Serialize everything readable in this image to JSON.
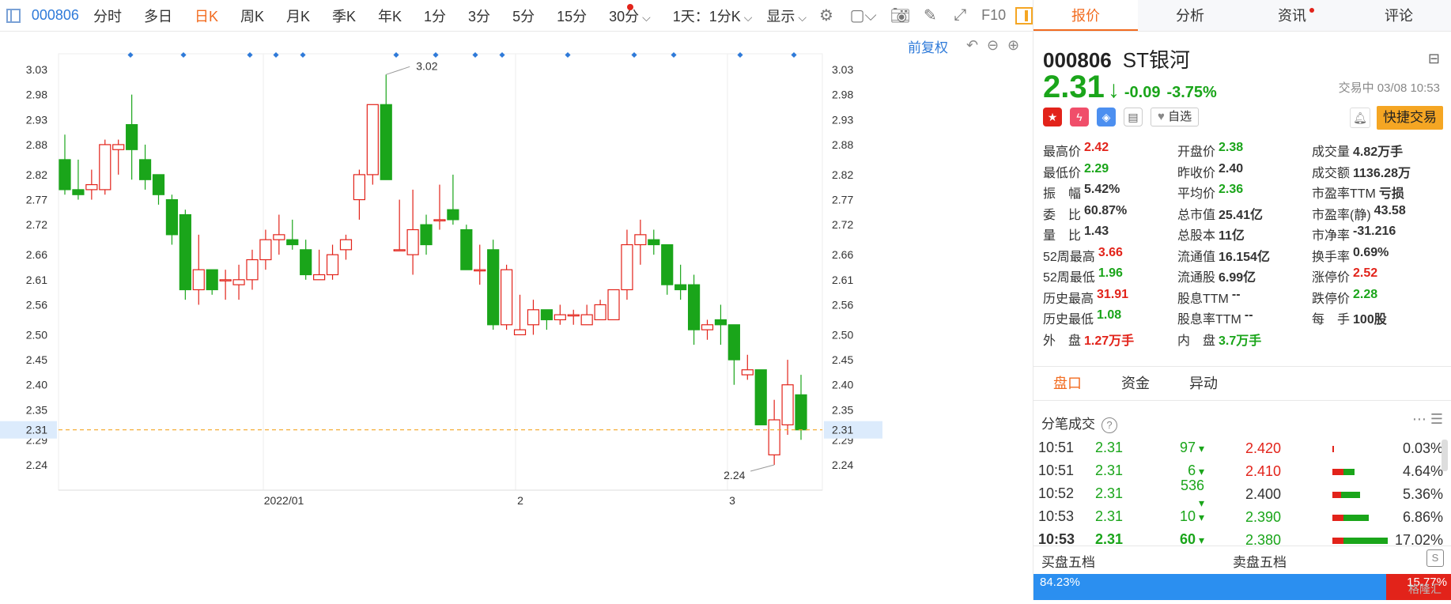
{
  "toolbar": {
    "code": "000806",
    "tabs": [
      "分时",
      "多日",
      "日K",
      "周K",
      "月K",
      "季K",
      "年K",
      "1分",
      "3分",
      "5分",
      "15分",
      "30分"
    ],
    "active_tab": "日K",
    "period_select": "1天：1分K",
    "display_select": "显示",
    "f10_label": "F10",
    "icons": [
      "settings-icon",
      "rect-icon",
      "camera-icon",
      "pencil-icon",
      "expand-icon"
    ]
  },
  "chart": {
    "adjust_label": "前复权",
    "current_price_tag": "2.31",
    "high_marker": "3.02",
    "low_marker": "2.24",
    "x_labels": [
      "2022/01",
      "2",
      "3"
    ],
    "y_labels": [
      "3.03",
      "2.98",
      "2.93",
      "2.88",
      "2.82",
      "2.77",
      "2.72",
      "2.66",
      "2.61",
      "2.56",
      "2.50",
      "2.45",
      "2.40",
      "2.35",
      "2.29",
      "2.24"
    ],
    "colors": {
      "up": "#e2231a",
      "down": "#1aa51a",
      "price_line": "#f5a623",
      "marker": "#2e7ad9"
    }
  },
  "chart_data": {
    "type": "candlestick",
    "x_labels": [
      "2022/01",
      "2",
      "3"
    ],
    "ylim": [
      2.22,
      3.05
    ],
    "candles": [
      {
        "o": 2.85,
        "h": 2.9,
        "l": 2.78,
        "c": 2.79
      },
      {
        "o": 2.79,
        "h": 2.85,
        "l": 2.77,
        "c": 2.78
      },
      {
        "o": 2.79,
        "h": 2.83,
        "l": 2.77,
        "c": 2.8
      },
      {
        "o": 2.79,
        "h": 2.89,
        "l": 2.78,
        "c": 2.88
      },
      {
        "o": 2.87,
        "h": 2.89,
        "l": 2.82,
        "c": 2.88
      },
      {
        "o": 2.92,
        "h": 2.98,
        "l": 2.81,
        "c": 2.87
      },
      {
        "o": 2.85,
        "h": 2.88,
        "l": 2.79,
        "c": 2.81
      },
      {
        "o": 2.82,
        "h": 2.82,
        "l": 2.76,
        "c": 2.78
      },
      {
        "o": 2.77,
        "h": 2.78,
        "l": 2.68,
        "c": 2.7
      },
      {
        "o": 2.74,
        "h": 2.75,
        "l": 2.57,
        "c": 2.59
      },
      {
        "o": 2.59,
        "h": 2.7,
        "l": 2.56,
        "c": 2.63
      },
      {
        "o": 2.63,
        "h": 2.63,
        "l": 2.58,
        "c": 2.59
      },
      {
        "o": 2.61,
        "h": 2.63,
        "l": 2.57,
        "c": 2.61
      },
      {
        "o": 2.6,
        "h": 2.64,
        "l": 2.57,
        "c": 2.61
      },
      {
        "o": 2.61,
        "h": 2.67,
        "l": 2.59,
        "c": 2.65
      },
      {
        "o": 2.65,
        "h": 2.71,
        "l": 2.63,
        "c": 2.69
      },
      {
        "o": 2.69,
        "h": 2.74,
        "l": 2.66,
        "c": 2.7
      },
      {
        "o": 2.69,
        "h": 2.73,
        "l": 2.67,
        "c": 2.68
      },
      {
        "o": 2.67,
        "h": 2.69,
        "l": 2.61,
        "c": 2.62
      },
      {
        "o": 2.61,
        "h": 2.67,
        "l": 2.61,
        "c": 2.62
      },
      {
        "o": 2.62,
        "h": 2.68,
        "l": 2.61,
        "c": 2.66
      },
      {
        "o": 2.67,
        "h": 2.7,
        "l": 2.65,
        "c": 2.69
      },
      {
        "o": 2.77,
        "h": 2.83,
        "l": 2.73,
        "c": 2.82
      },
      {
        "o": 2.82,
        "h": 2.96,
        "l": 2.8,
        "c": 2.96
      },
      {
        "o": 2.96,
        "h": 3.02,
        "l": 2.81,
        "c": 2.81
      },
      {
        "o": 2.67,
        "h": 2.77,
        "l": 2.67,
        "c": 2.67
      },
      {
        "o": 2.66,
        "h": 2.79,
        "l": 2.62,
        "c": 2.71
      },
      {
        "o": 2.72,
        "h": 2.74,
        "l": 2.66,
        "c": 2.68
      },
      {
        "o": 2.73,
        "h": 2.8,
        "l": 2.71,
        "c": 2.73
      },
      {
        "o": 2.75,
        "h": 2.82,
        "l": 2.72,
        "c": 2.73
      },
      {
        "o": 2.71,
        "h": 2.72,
        "l": 2.63,
        "c": 2.63
      },
      {
        "o": 2.63,
        "h": 2.68,
        "l": 2.6,
        "c": 2.63
      },
      {
        "o": 2.67,
        "h": 2.69,
        "l": 2.51,
        "c": 2.52
      },
      {
        "o": 2.52,
        "h": 2.64,
        "l": 2.51,
        "c": 2.63
      },
      {
        "o": 2.5,
        "h": 2.58,
        "l": 2.5,
        "c": 2.51
      },
      {
        "o": 2.52,
        "h": 2.57,
        "l": 2.5,
        "c": 2.55
      },
      {
        "o": 2.55,
        "h": 2.55,
        "l": 2.51,
        "c": 2.53
      },
      {
        "o": 2.53,
        "h": 2.56,
        "l": 2.52,
        "c": 2.54
      },
      {
        "o": 2.54,
        "h": 2.55,
        "l": 2.52,
        "c": 2.54
      },
      {
        "o": 2.52,
        "h": 2.56,
        "l": 2.52,
        "c": 2.54
      },
      {
        "o": 2.53,
        "h": 2.57,
        "l": 2.53,
        "c": 2.56
      },
      {
        "o": 2.53,
        "h": 2.59,
        "l": 2.53,
        "c": 2.59
      },
      {
        "o": 2.59,
        "h": 2.71,
        "l": 2.57,
        "c": 2.68
      },
      {
        "o": 2.68,
        "h": 2.73,
        "l": 2.64,
        "c": 2.7
      },
      {
        "o": 2.69,
        "h": 2.71,
        "l": 2.66,
        "c": 2.68
      },
      {
        "o": 2.68,
        "h": 2.68,
        "l": 2.58,
        "c": 2.6
      },
      {
        "o": 2.6,
        "h": 2.64,
        "l": 2.57,
        "c": 2.59
      },
      {
        "o": 2.6,
        "h": 2.62,
        "l": 2.48,
        "c": 2.51
      },
      {
        "o": 2.51,
        "h": 2.53,
        "l": 2.49,
        "c": 2.52
      },
      {
        "o": 2.53,
        "h": 2.56,
        "l": 2.48,
        "c": 2.52
      },
      {
        "o": 2.52,
        "h": 2.52,
        "l": 2.4,
        "c": 2.45
      },
      {
        "o": 2.42,
        "h": 2.46,
        "l": 2.41,
        "c": 2.43
      },
      {
        "o": 2.43,
        "h": 2.43,
        "l": 2.32,
        "c": 2.32
      },
      {
        "o": 2.26,
        "h": 2.37,
        "l": 2.24,
        "c": 2.33
      },
      {
        "o": 2.32,
        "h": 2.45,
        "l": 2.3,
        "c": 2.4
      },
      {
        "o": 2.38,
        "h": 2.42,
        "l": 2.29,
        "c": 2.31
      }
    ]
  },
  "panel": {
    "tabs": [
      "报价",
      "分析",
      "资讯",
      "评论"
    ],
    "active_tab": "报价",
    "code": "000806",
    "name": "ST银河",
    "price": "2.31",
    "change": "-0.09",
    "change_pct": "-3.75%",
    "trade_time": "交易中 03/08 10:53",
    "watch_label": "自选",
    "quick_trade": "快捷交易",
    "quotes": [
      [
        [
          "最高价",
          "2.42",
          "red"
        ],
        [
          "开盘价",
          "2.38",
          "grn"
        ],
        [
          "成交量",
          "4.82万手",
          ""
        ]
      ],
      [
        [
          "最低价",
          "2.29",
          "grn"
        ],
        [
          "昨收价",
          "2.40",
          ""
        ],
        [
          "成交额",
          "1136.28万",
          ""
        ]
      ],
      [
        [
          "振　幅",
          "5.42%",
          ""
        ],
        [
          "平均价",
          "2.36",
          "grn"
        ],
        [
          "市盈率TTM",
          "亏损",
          ""
        ]
      ],
      [
        [
          "委　比",
          "60.87%",
          ""
        ],
        [
          "总市值",
          "25.41亿",
          ""
        ],
        [
          "市盈率(静)",
          "43.58",
          ""
        ]
      ],
      [
        [
          "量　比",
          "1.43",
          ""
        ],
        [
          "总股本",
          "11亿",
          ""
        ],
        [
          "市净率",
          "-31.216",
          ""
        ]
      ],
      [
        [
          "52周最高",
          "3.66",
          "red"
        ],
        [
          "流通值",
          "16.154亿",
          ""
        ],
        [
          "换手率",
          "0.69%",
          ""
        ]
      ],
      [
        [
          "52周最低",
          "1.96",
          "grn"
        ],
        [
          "流通股",
          "6.99亿",
          ""
        ],
        [
          "涨停价",
          "2.52",
          "red"
        ]
      ],
      [
        [
          "历史最高",
          "31.91",
          "red"
        ],
        [
          "股息TTM",
          "--",
          ""
        ],
        [
          "跌停价",
          "2.28",
          "grn"
        ]
      ],
      [
        [
          "历史最低",
          "1.08",
          "grn"
        ],
        [
          "股息率TTM",
          "--",
          ""
        ],
        [
          "每　手",
          "100股",
          ""
        ]
      ],
      [
        [
          "外　盘",
          "1.27万手",
          "red"
        ],
        [
          "内　盘",
          "3.7万手",
          "grn"
        ],
        [
          "",
          "",
          ""
        ]
      ]
    ],
    "sub_tabs": [
      "盘口",
      "资金",
      "异动"
    ],
    "ticks_title": "分笔成交",
    "ticks": [
      {
        "t": "10:51",
        "p": "2.31",
        "n": "97"
      },
      {
        "t": "10:51",
        "p": "2.31",
        "n": "6"
      },
      {
        "t": "10:52",
        "p": "2.31",
        "n": "536"
      },
      {
        "t": "10:53",
        "p": "2.31",
        "n": "10"
      },
      {
        "t": "10:53",
        "p": "2.31",
        "n": "60"
      }
    ],
    "depth": [
      {
        "price": "2.420",
        "pct": "0.03%",
        "color": "red",
        "r": 0.02,
        "g": 0.0
      },
      {
        "price": "2.410",
        "pct": "4.64%",
        "color": "red",
        "r": 0.2,
        "g": 0.2
      },
      {
        "price": "2.400",
        "pct": "5.36%",
        "color": "",
        "r": 0.15,
        "g": 0.35
      },
      {
        "price": "2.390",
        "pct": "6.86%",
        "color": "grn",
        "r": 0.2,
        "g": 0.45
      },
      {
        "price": "2.380",
        "pct": "17.02%",
        "color": "grn",
        "r": 0.2,
        "g": 0.8
      }
    ],
    "buy_five": "买盘五档",
    "sell_five": "卖盘五档",
    "buy_pct": "84.23%",
    "sell_pct": "15.77%",
    "watermark": "格隆汇"
  }
}
